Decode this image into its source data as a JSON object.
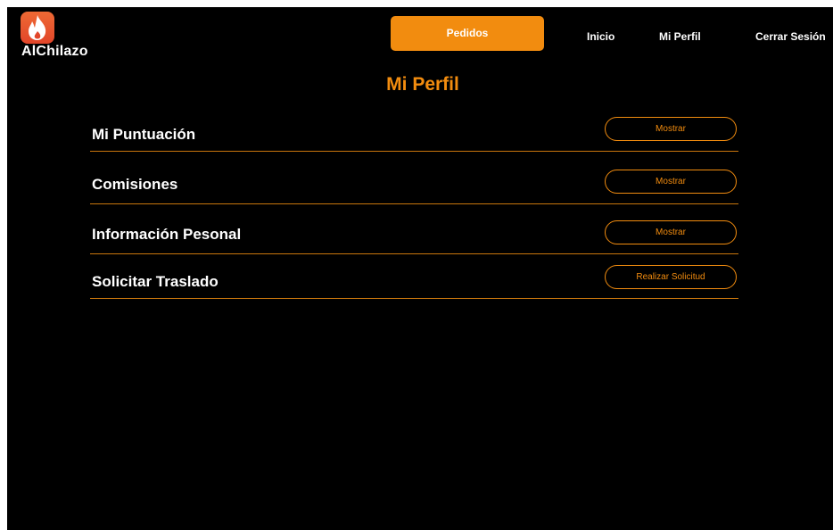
{
  "app": {
    "brand_name": "AlChilazo",
    "logo_icon": "flame-icon"
  },
  "nav": {
    "primary_label": "Pedidos",
    "links": [
      {
        "label": "Inicio"
      },
      {
        "label": "Mi Perfil"
      },
      {
        "label": "Cerrar Sesión"
      }
    ]
  },
  "page": {
    "title": "Mi Perfil"
  },
  "sections": [
    {
      "label": "Mi Puntuación",
      "button_label": "Mostrar"
    },
    {
      "label": "Comisiones",
      "button_label": "Mostrar"
    },
    {
      "label": "Información Pesonal",
      "button_label": "Mostrar"
    },
    {
      "label": "Solicitar Traslado",
      "button_label": "Realizar Solicitud"
    }
  ],
  "colors": {
    "background": "#000000",
    "accent": "#f28c0f",
    "text": "#ffffff",
    "logo_bg": "#e2462a"
  }
}
